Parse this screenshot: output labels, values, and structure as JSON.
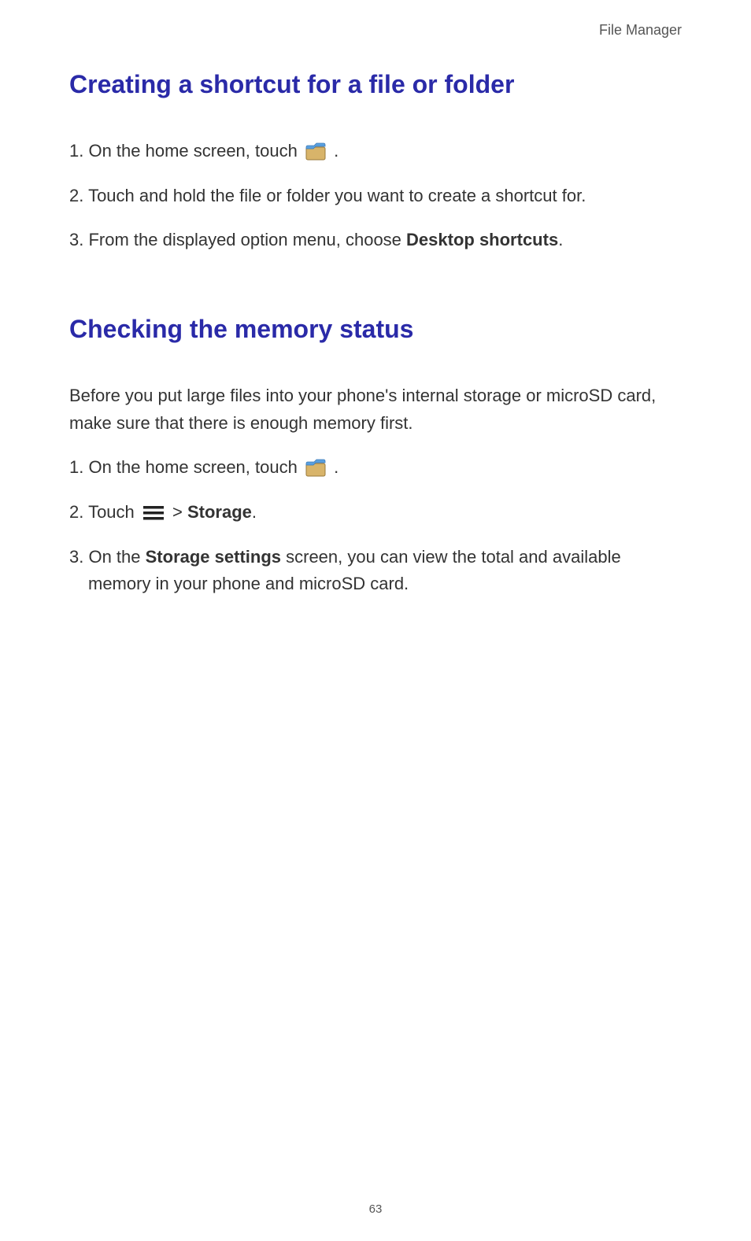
{
  "header": {
    "label": "File Manager"
  },
  "section1": {
    "heading": "Creating a shortcut for a file or folder",
    "step1_prefix": "1. On the home screen, touch ",
    "step1_suffix": " .",
    "step2": "2. Touch and hold the file or folder you want to create a shortcut for.",
    "step3_prefix": "3. From the displayed option menu, choose ",
    "step3_bold": "Desktop shortcuts",
    "step3_suffix": "."
  },
  "section2": {
    "heading": "Checking the memory status",
    "intro": "Before you put large files into your phone's internal storage or microSD card, make sure that there is enough memory first.",
    "step1_prefix": "1. On the home screen, touch ",
    "step1_suffix": " .",
    "step2_prefix": "2. Touch ",
    "step2_mid": " > ",
    "step2_bold": "Storage",
    "step2_suffix": ".",
    "step3_prefix": "3. On the ",
    "step3_bold": "Storage settings",
    "step3_mid": " screen, you can view the total and available ",
    "step3_cont": "memory in your phone and microSD card."
  },
  "page_number": "63"
}
